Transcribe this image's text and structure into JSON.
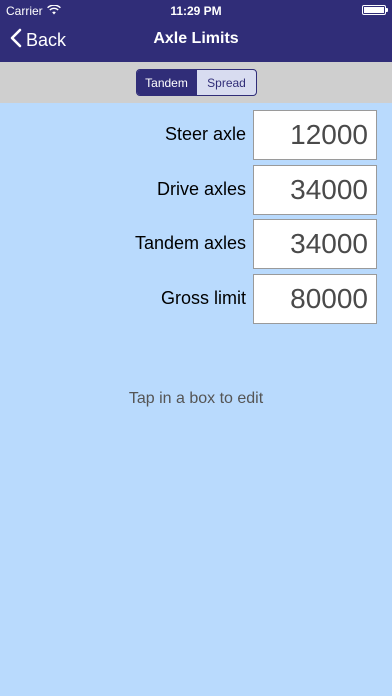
{
  "status_bar": {
    "carrier": "Carrier",
    "time": "11:29 PM",
    "battery_level": 1.0
  },
  "nav": {
    "back_label": "Back",
    "title": "Axle Limits"
  },
  "segmented": {
    "options": [
      "Tandem",
      "Spread"
    ],
    "selected": "Tandem"
  },
  "limits": [
    {
      "label": "Steer axle",
      "value": "12000"
    },
    {
      "label": "Drive axles",
      "value": "34000"
    },
    {
      "label": "Tandem axles",
      "value": "34000"
    },
    {
      "label": "Gross limit",
      "value": "80000"
    }
  ],
  "hint": "Tap in a box to edit",
  "colors": {
    "bar": "#302d78",
    "background": "#b9dafd",
    "segment_bar": "#cfcfcf"
  },
  "icons": {
    "back": "chevron-left-icon",
    "wifi": "wifi-icon",
    "battery": "battery-icon"
  }
}
